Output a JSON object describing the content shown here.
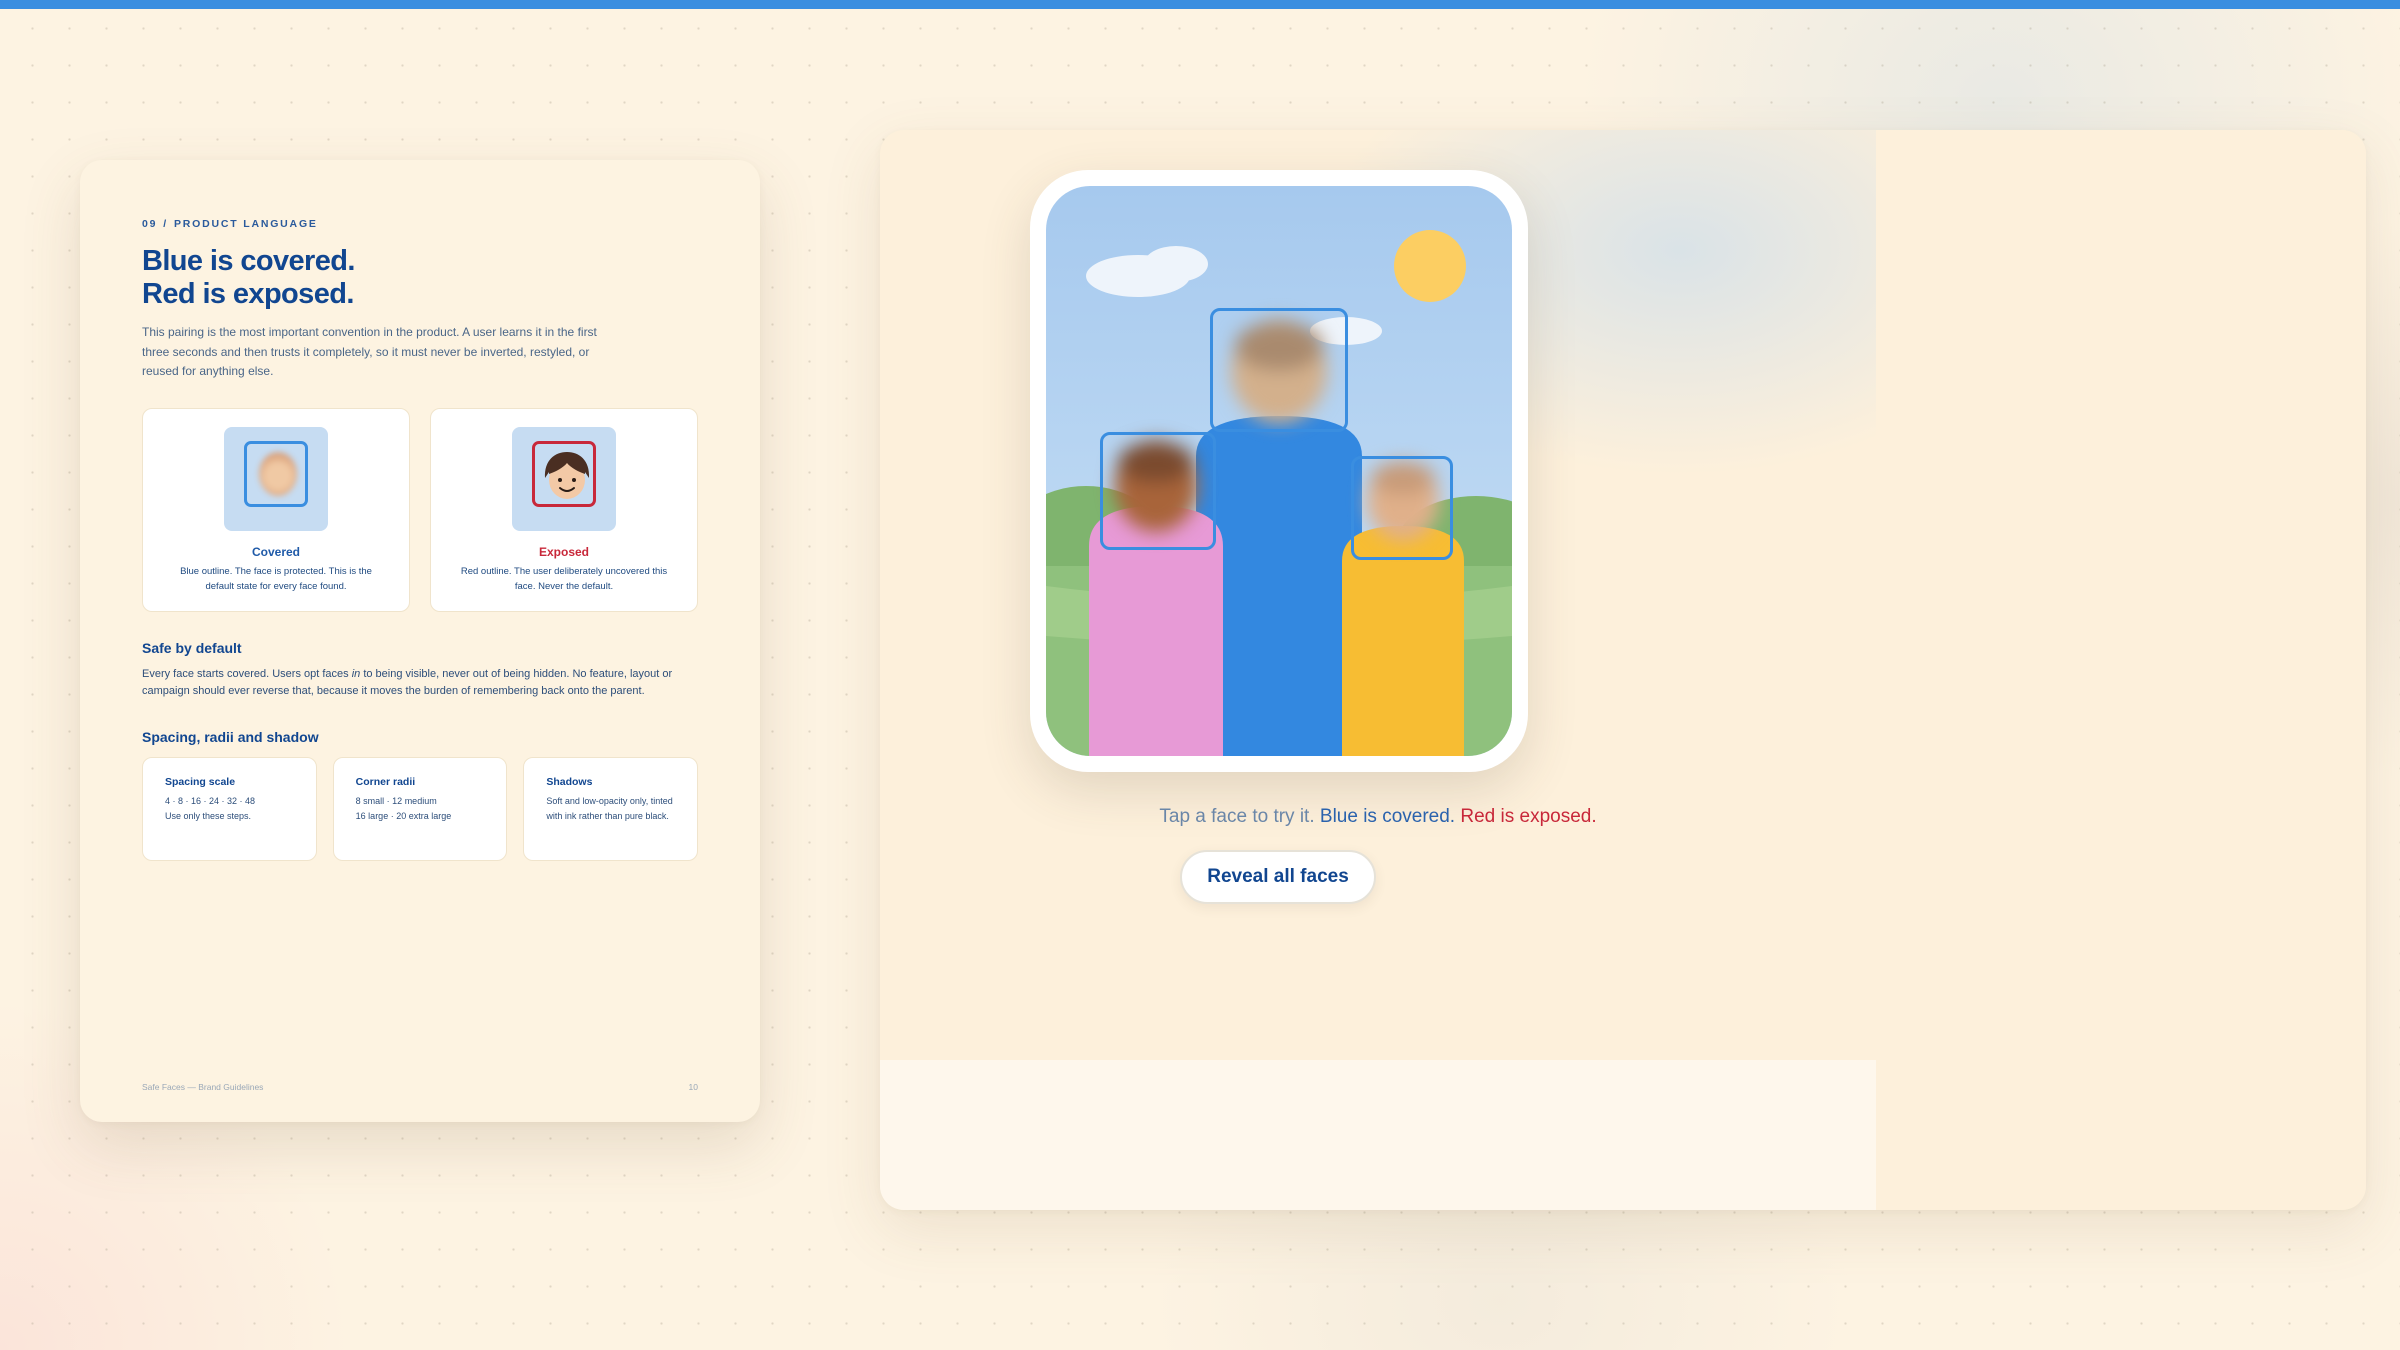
{
  "colors": {
    "covered": "#3a8ee0",
    "exposed": "#c8283a",
    "ink": "#114690",
    "accent_bar": "#3a8ee0"
  },
  "page": {
    "eyebrow_number": "09",
    "eyebrow_sep": "/",
    "eyebrow_label": "PRODUCT LANGUAGE",
    "headline_line1": "Blue is covered.",
    "headline_line2": "Red is exposed.",
    "intro": "This pairing is the most important convention in the product. A user learns it in the first three seconds and then trusts it completely, so it must never be inverted, restyled, or reused for anything else.",
    "tiles": [
      {
        "title": "Covered",
        "desc": "Blue outline. The face is protected. This is the default state for every face found.",
        "icon": "blurred-face-icon"
      },
      {
        "title": "Exposed",
        "desc": "Red outline. The user deliberately uncovered this face. Never the default.",
        "icon": "smiling-face-icon"
      }
    ],
    "safe_heading": "Safe by default",
    "safe_body_1": "Every face starts covered. Users opt faces ",
    "safe_body_em": "in",
    "safe_body_2": " to being visible, never out of being hidden. No feature, layout or campaign should ever reverse that, because it moves the burden of remembering back onto the parent.",
    "spacing_heading": "Spacing, radii and shadow",
    "cards": [
      {
        "title": "Spacing scale",
        "line1": "4 · 8 · 16 · 24 · 32 · 48",
        "line2": "Use only these steps."
      },
      {
        "title": "Corner radii",
        "line1": "8 small · 12 medium",
        "line2": "16 large · 20 extra large"
      },
      {
        "title": "Shadows",
        "line1": "Soft and low-opacity only, tinted with ink rather than pure black.",
        "line2": ""
      }
    ],
    "footer_left": "Safe Faces — Brand Guidelines",
    "footer_right": "10"
  },
  "demo": {
    "caption_muted": "Tap a face to try it.",
    "caption_blue": "Blue is covered.",
    "caption_red": "Red is exposed.",
    "button_label": "Reveal all faces"
  }
}
